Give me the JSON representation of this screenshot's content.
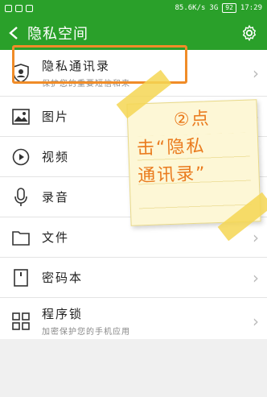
{
  "status_bar": {
    "network_speed": "85.6K/s",
    "signal": "3G",
    "battery": "92",
    "time": "17:29"
  },
  "app_bar": {
    "title": "隐私空间"
  },
  "list": [
    {
      "label": "隐私通讯录",
      "subtitle": "保护您的重要短信和来",
      "icon": "shield-person-icon"
    },
    {
      "label": "图片",
      "subtitle": "",
      "icon": "image-icon"
    },
    {
      "label": "视频",
      "subtitle": "",
      "icon": "play-icon"
    },
    {
      "label": "录音",
      "subtitle": "",
      "icon": "microphone-icon"
    },
    {
      "label": "文件",
      "subtitle": "",
      "icon": "folder-icon"
    },
    {
      "label": "密码本",
      "subtitle": "",
      "icon": "notebook-icon"
    },
    {
      "label": "程序锁",
      "subtitle": "加密保护您的手机应用",
      "icon": "app-grid-icon"
    }
  ],
  "annotation": {
    "line1": "②点",
    "line2": "击“隐私",
    "line3": "通讯录”"
  },
  "colors": {
    "app_bar": "#2aa02a",
    "highlight": "#f08c28",
    "note_text": "#ea7b1e"
  }
}
